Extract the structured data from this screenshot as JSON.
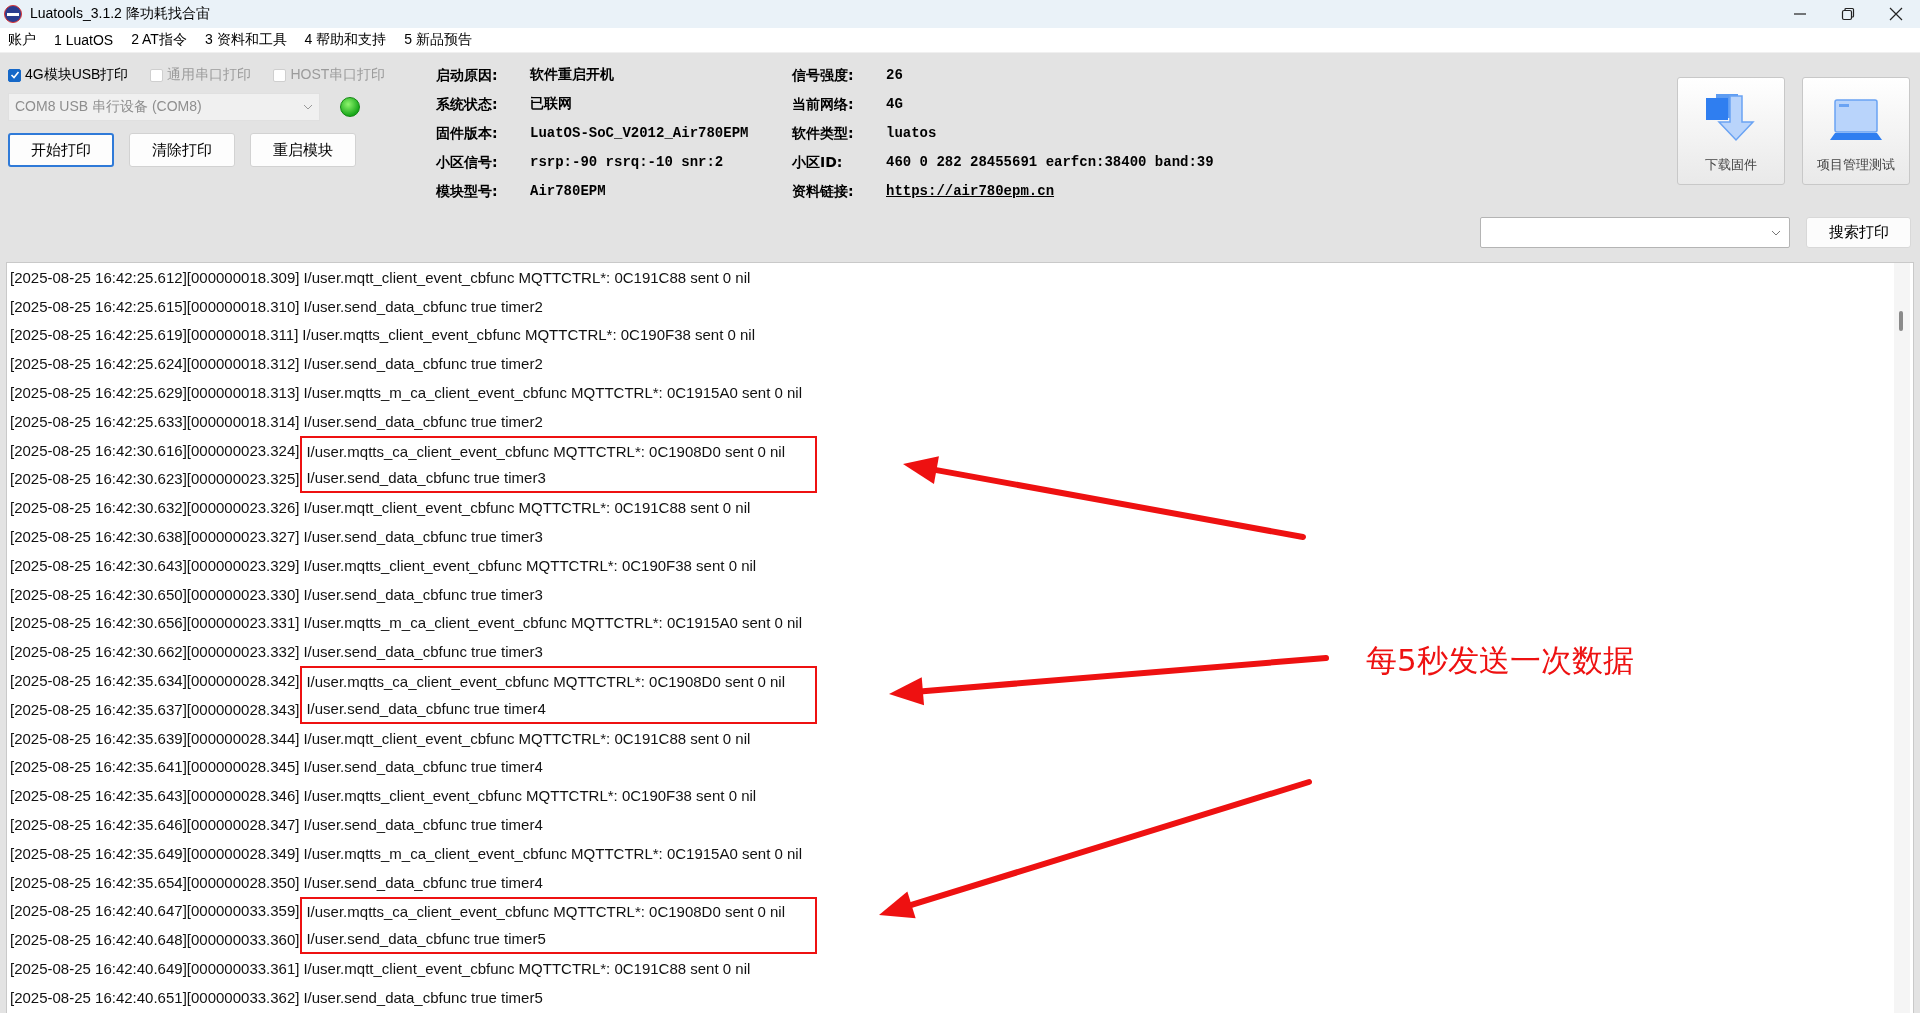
{
  "window": {
    "title": "Luatools_3.1.2 降功耗找合宙"
  },
  "menu": [
    "账户",
    "1 LuatOS",
    "2 AT指令",
    "3 资料和工具",
    "4 帮助和支持",
    "5 新品预告"
  ],
  "print_options": [
    {
      "label": "4G模块USB打印",
      "checked": true,
      "disabled": false
    },
    {
      "label": "通用串口打印",
      "checked": false,
      "disabled": true
    },
    {
      "label": "HOST串口打印",
      "checked": false,
      "disabled": true
    }
  ],
  "port_select": {
    "value": "COM8 USB 串行设备 (COM8)",
    "disabled": true
  },
  "connection_led": {
    "on": true
  },
  "buttons": [
    {
      "label": "开始打印",
      "focused": true
    },
    {
      "label": "清除打印",
      "focused": false
    },
    {
      "label": "重启模块",
      "focused": false
    }
  ],
  "device_info": [
    {
      "label": "启动原因:",
      "value": "软件重启开机",
      "kind": "text"
    },
    {
      "label": "信号强度:",
      "value": "26",
      "kind": "text"
    },
    {
      "label": "系统状态:",
      "value": "已联网",
      "kind": "text"
    },
    {
      "label": "当前网络:",
      "value": "4G",
      "kind": "text"
    },
    {
      "label": "固件版本:",
      "value": "LuatOS-SoC_V2012_Air780EPM",
      "kind": "text"
    },
    {
      "label": "软件类型:",
      "value": "luatos",
      "kind": "text"
    },
    {
      "label": "小区信号:",
      "value": "rsrp:-90 rsrq:-10 snr:2",
      "kind": "text"
    },
    {
      "label": "小区ID:",
      "value": "460 0 282 28455691 earfcn:38400 band:39",
      "kind": "text"
    },
    {
      "label": "模块型号:",
      "value": "Air780EPM",
      "kind": "text"
    },
    {
      "label": "资料链接:",
      "value": "https://air780epm.cn",
      "kind": "link"
    }
  ],
  "tool_buttons": [
    {
      "label": "下载固件",
      "kind": "download"
    },
    {
      "label": "项目管理测试",
      "kind": "project"
    }
  ],
  "search": {
    "button": "搜索打印"
  },
  "log": [
    {
      "prefix": "[2025-08-25 16:42:25.612][000000018.309]",
      "message": "I/user.mqtt_client_event_cbfunc MQTTCTRL*: 0C191C88 sent 0 nil",
      "boxed": false
    },
    {
      "prefix": "[2025-08-25 16:42:25.615][000000018.310]",
      "message": "I/user.send_data_cbfunc true timer2",
      "boxed": false
    },
    {
      "prefix": "[2025-08-25 16:42:25.619][000000018.311]",
      "message": "I/user.mqtts_client_event_cbfunc MQTTCTRL*: 0C190F38 sent 0 nil",
      "boxed": false
    },
    {
      "prefix": "[2025-08-25 16:42:25.624][000000018.312]",
      "message": "I/user.send_data_cbfunc true timer2",
      "boxed": false
    },
    {
      "prefix": "[2025-08-25 16:42:25.629][000000018.313]",
      "message": "I/user.mqtts_m_ca_client_event_cbfunc MQTTCTRL*: 0C1915A0 sent 0 nil",
      "boxed": false
    },
    {
      "prefix": "[2025-08-25 16:42:25.633][000000018.314]",
      "message": "I/user.send_data_cbfunc true timer2",
      "boxed": false
    },
    {
      "prefix": "[2025-08-25 16:42:30.616][000000023.324]",
      "message": "I/user.mqtts_ca_client_event_cbfunc MQTTCTRL*: 0C1908D0 sent 0 nil",
      "boxed": true
    },
    {
      "prefix": "[2025-08-25 16:42:30.623][000000023.325]",
      "message": "I/user.send_data_cbfunc true timer3",
      "boxed": true
    },
    {
      "prefix": "[2025-08-25 16:42:30.632][000000023.326]",
      "message": "I/user.mqtt_client_event_cbfunc MQTTCTRL*: 0C191C88 sent 0 nil",
      "boxed": false
    },
    {
      "prefix": "[2025-08-25 16:42:30.638][000000023.327]",
      "message": "I/user.send_data_cbfunc true timer3",
      "boxed": false
    },
    {
      "prefix": "[2025-08-25 16:42:30.643][000000023.329]",
      "message": "I/user.mqtts_client_event_cbfunc MQTTCTRL*: 0C190F38 sent 0 nil",
      "boxed": false
    },
    {
      "prefix": "[2025-08-25 16:42:30.650][000000023.330]",
      "message": "I/user.send_data_cbfunc true timer3",
      "boxed": false
    },
    {
      "prefix": "[2025-08-25 16:42:30.656][000000023.331]",
      "message": "I/user.mqtts_m_ca_client_event_cbfunc MQTTCTRL*: 0C1915A0 sent 0 nil",
      "boxed": false
    },
    {
      "prefix": "[2025-08-25 16:42:30.662][000000023.332]",
      "message": "I/user.send_data_cbfunc true timer3",
      "boxed": false
    },
    {
      "prefix": "[2025-08-25 16:42:35.634][000000028.342]",
      "message": "I/user.mqtts_ca_client_event_cbfunc MQTTCTRL*: 0C1908D0 sent 0 nil",
      "boxed": true
    },
    {
      "prefix": "[2025-08-25 16:42:35.637][000000028.343]",
      "message": "I/user.send_data_cbfunc true timer4",
      "boxed": true
    },
    {
      "prefix": "[2025-08-25 16:42:35.639][000000028.344]",
      "message": "I/user.mqtt_client_event_cbfunc MQTTCTRL*: 0C191C88 sent 0 nil",
      "boxed": false
    },
    {
      "prefix": "[2025-08-25 16:42:35.641][000000028.345]",
      "message": "I/user.send_data_cbfunc true timer4",
      "boxed": false
    },
    {
      "prefix": "[2025-08-25 16:42:35.643][000000028.346]",
      "message": "I/user.mqtts_client_event_cbfunc MQTTCTRL*: 0C190F38 sent 0 nil",
      "boxed": false
    },
    {
      "prefix": "[2025-08-25 16:42:35.646][000000028.347]",
      "message": "I/user.send_data_cbfunc true timer4",
      "boxed": false
    },
    {
      "prefix": "[2025-08-25 16:42:35.649][000000028.349]",
      "message": "I/user.mqtts_m_ca_client_event_cbfunc MQTTCTRL*: 0C1915A0 sent 0 nil",
      "boxed": false
    },
    {
      "prefix": "[2025-08-25 16:42:35.654][000000028.350]",
      "message": "I/user.send_data_cbfunc true timer4",
      "boxed": false
    },
    {
      "prefix": "[2025-08-25 16:42:40.647][000000033.359]",
      "message": "I/user.mqtts_ca_client_event_cbfunc MQTTCTRL*: 0C1908D0 sent 0 nil",
      "boxed": true
    },
    {
      "prefix": "[2025-08-25 16:42:40.648][000000033.360]",
      "message": "I/user.send_data_cbfunc true timer5",
      "boxed": true
    },
    {
      "prefix": "[2025-08-25 16:42:40.649][000000033.361]",
      "message": "I/user.mqtt_client_event_cbfunc MQTTCTRL*: 0C191C88 sent 0 nil",
      "boxed": false
    },
    {
      "prefix": "[2025-08-25 16:42:40.651][000000033.362]",
      "message": "I/user.send_data_cbfunc true timer5",
      "boxed": false
    }
  ],
  "annotation": {
    "text": "每5秒发送一次数据"
  }
}
